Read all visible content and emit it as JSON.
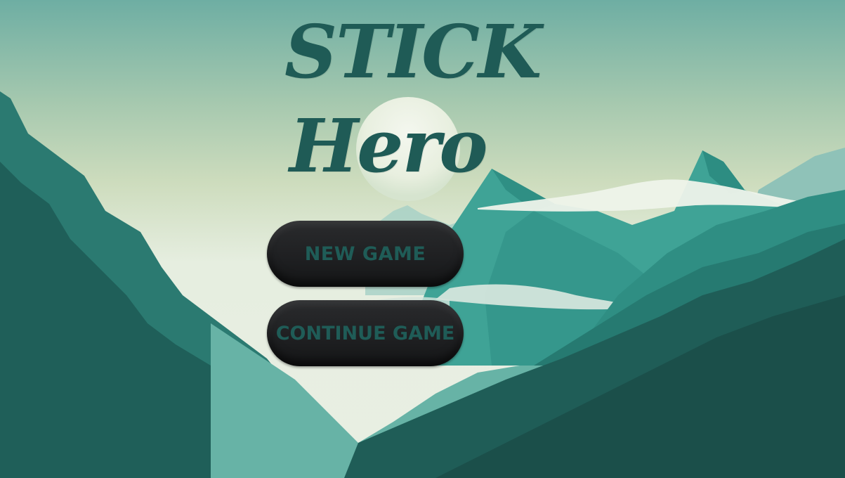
{
  "title": {
    "line1": "STICK",
    "line2": "Hero"
  },
  "menu": {
    "new_game_label": "NEW GAME",
    "continue_game_label": "CONTINUE GAME"
  },
  "colors": {
    "title_text": "#1f5b56",
    "button_bg": "#1e1f21",
    "button_text": "#1f5c57",
    "sky_top": "#6fb0a5",
    "sky_mid": "#c2d8b6",
    "sky_haze": "#e8efe2",
    "mountain_dark": "#1e5a55",
    "mountain_mid": "#2c8b83",
    "mountain_light": "#3fa59a"
  },
  "icons": {
    "sun": "sun-icon"
  }
}
